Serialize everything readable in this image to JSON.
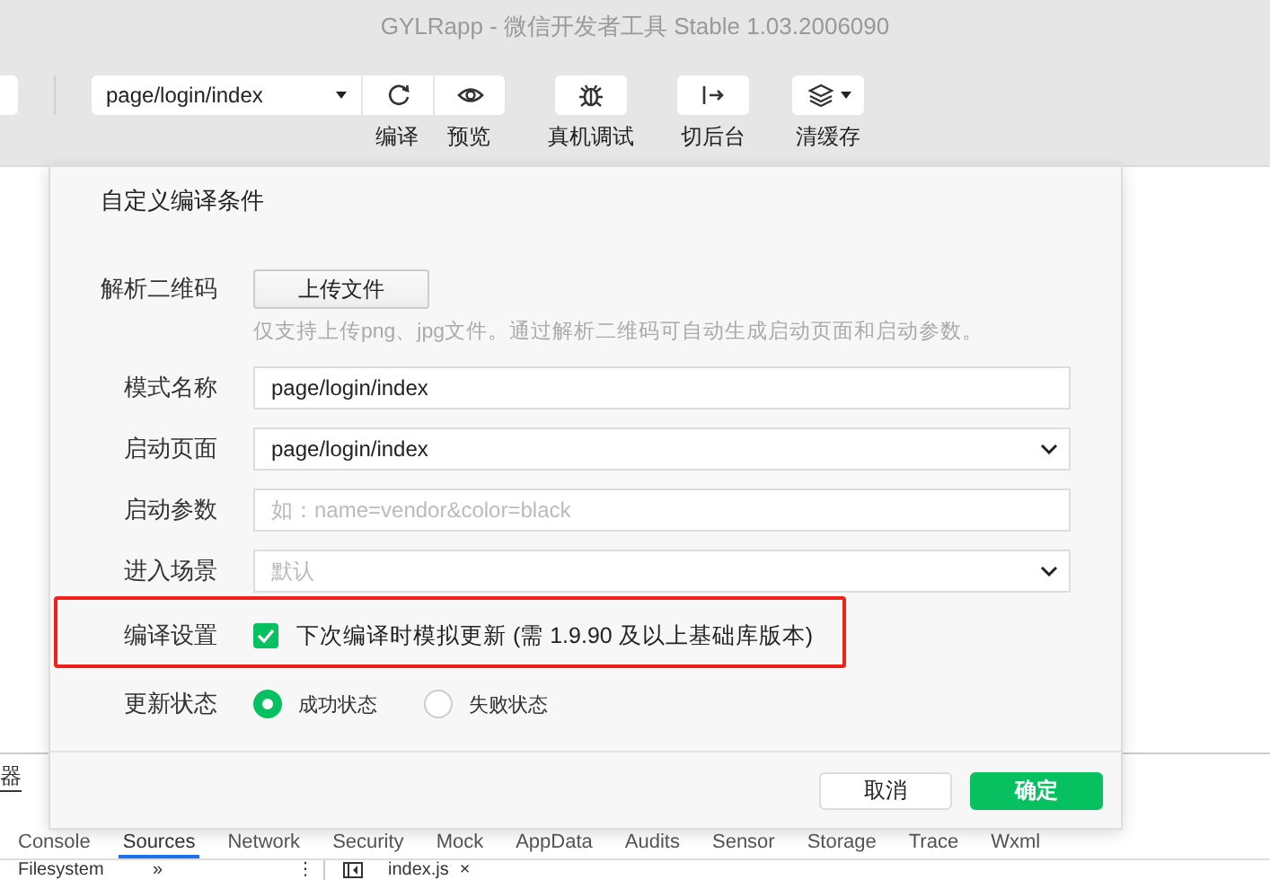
{
  "window": {
    "title": "GYLRapp - 微信开发者工具 Stable 1.03.2006090"
  },
  "toolbar": {
    "page_select": "page/login/index",
    "buttons": [
      {
        "kind": "compile",
        "label": "编译"
      },
      {
        "kind": "preview",
        "label": "预览"
      },
      {
        "kind": "debug",
        "label": "真机调试"
      },
      {
        "kind": "background",
        "label": "切后台"
      },
      {
        "kind": "cache",
        "label": "清缓存"
      }
    ]
  },
  "dialog": {
    "title": "自定义编译条件",
    "rows": [
      {
        "kind": "upload",
        "label": "解析二维码",
        "button": "上传文件",
        "hint": "仅支持上传png、jpg文件。通过解析二维码可自动生成启动页面和启动参数。"
      },
      {
        "kind": "text",
        "label": "模式名称",
        "value": "page/login/index"
      },
      {
        "kind": "select",
        "label": "启动页面",
        "value": "page/login/index"
      },
      {
        "kind": "text",
        "label": "启动参数",
        "placeholder": "如：name=vendor&color=black"
      },
      {
        "kind": "select",
        "label": "进入场景",
        "placeholder": "默认"
      },
      {
        "kind": "checkbox",
        "label": "编译设置",
        "text": "下次编译时模拟更新 (需 1.9.90 及以上基础库版本)",
        "checked": true,
        "highlighted": true
      },
      {
        "kind": "radio",
        "label": "更新状态",
        "options": [
          {
            "label": "成功状态",
            "selected": true
          },
          {
            "label": "失败状态",
            "selected": false
          }
        ]
      }
    ],
    "buttons": [
      {
        "kind": "secondary",
        "label": "取消"
      },
      {
        "kind": "primary",
        "label": "确定"
      }
    ]
  },
  "devtools": {
    "panel_tab": "器",
    "tabs": [
      {
        "label": "Console",
        "selected": false
      },
      {
        "label": "Sources",
        "selected": true
      },
      {
        "label": "Network",
        "selected": false
      },
      {
        "label": "Security",
        "selected": false
      },
      {
        "label": "Mock",
        "selected": false
      },
      {
        "label": "AppData",
        "selected": false
      },
      {
        "label": "Audits",
        "selected": false
      },
      {
        "label": "Sensor",
        "selected": false
      },
      {
        "label": "Storage",
        "selected": false
      },
      {
        "label": "Trace",
        "selected": false
      },
      {
        "label": "Wxml",
        "selected": false
      }
    ],
    "sidebar_tab": "Filesystem",
    "more": "»",
    "menu": "⋮",
    "open_file": {
      "name": "index.js",
      "close": "×"
    }
  }
}
